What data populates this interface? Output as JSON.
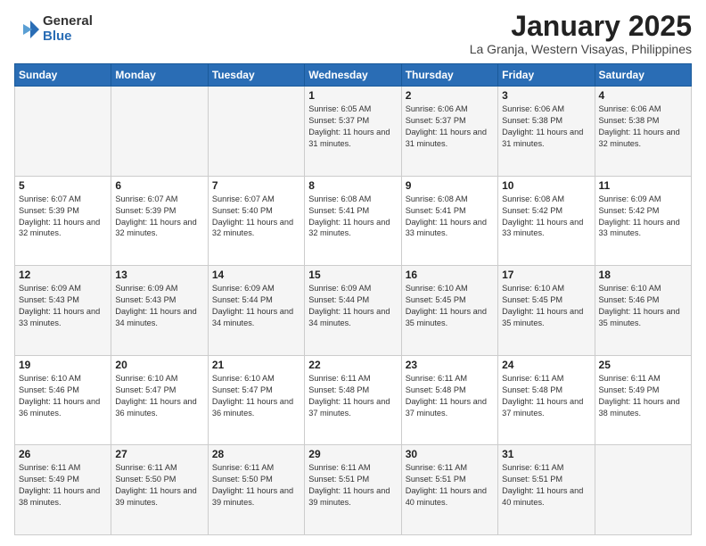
{
  "header": {
    "logo_general": "General",
    "logo_blue": "Blue",
    "month_title": "January 2025",
    "subtitle": "La Granja, Western Visayas, Philippines"
  },
  "weekdays": [
    "Sunday",
    "Monday",
    "Tuesday",
    "Wednesday",
    "Thursday",
    "Friday",
    "Saturday"
  ],
  "weeks": [
    [
      {
        "day": "",
        "info": ""
      },
      {
        "day": "",
        "info": ""
      },
      {
        "day": "",
        "info": ""
      },
      {
        "day": "1",
        "info": "Sunrise: 6:05 AM\nSunset: 5:37 PM\nDaylight: 11 hours\nand 31 minutes."
      },
      {
        "day": "2",
        "info": "Sunrise: 6:06 AM\nSunset: 5:37 PM\nDaylight: 11 hours\nand 31 minutes."
      },
      {
        "day": "3",
        "info": "Sunrise: 6:06 AM\nSunset: 5:38 PM\nDaylight: 11 hours\nand 31 minutes."
      },
      {
        "day": "4",
        "info": "Sunrise: 6:06 AM\nSunset: 5:38 PM\nDaylight: 11 hours\nand 32 minutes."
      }
    ],
    [
      {
        "day": "5",
        "info": "Sunrise: 6:07 AM\nSunset: 5:39 PM\nDaylight: 11 hours\nand 32 minutes."
      },
      {
        "day": "6",
        "info": "Sunrise: 6:07 AM\nSunset: 5:39 PM\nDaylight: 11 hours\nand 32 minutes."
      },
      {
        "day": "7",
        "info": "Sunrise: 6:07 AM\nSunset: 5:40 PM\nDaylight: 11 hours\nand 32 minutes."
      },
      {
        "day": "8",
        "info": "Sunrise: 6:08 AM\nSunset: 5:41 PM\nDaylight: 11 hours\nand 32 minutes."
      },
      {
        "day": "9",
        "info": "Sunrise: 6:08 AM\nSunset: 5:41 PM\nDaylight: 11 hours\nand 33 minutes."
      },
      {
        "day": "10",
        "info": "Sunrise: 6:08 AM\nSunset: 5:42 PM\nDaylight: 11 hours\nand 33 minutes."
      },
      {
        "day": "11",
        "info": "Sunrise: 6:09 AM\nSunset: 5:42 PM\nDaylight: 11 hours\nand 33 minutes."
      }
    ],
    [
      {
        "day": "12",
        "info": "Sunrise: 6:09 AM\nSunset: 5:43 PM\nDaylight: 11 hours\nand 33 minutes."
      },
      {
        "day": "13",
        "info": "Sunrise: 6:09 AM\nSunset: 5:43 PM\nDaylight: 11 hours\nand 34 minutes."
      },
      {
        "day": "14",
        "info": "Sunrise: 6:09 AM\nSunset: 5:44 PM\nDaylight: 11 hours\nand 34 minutes."
      },
      {
        "day": "15",
        "info": "Sunrise: 6:09 AM\nSunset: 5:44 PM\nDaylight: 11 hours\nand 34 minutes."
      },
      {
        "day": "16",
        "info": "Sunrise: 6:10 AM\nSunset: 5:45 PM\nDaylight: 11 hours\nand 35 minutes."
      },
      {
        "day": "17",
        "info": "Sunrise: 6:10 AM\nSunset: 5:45 PM\nDaylight: 11 hours\nand 35 minutes."
      },
      {
        "day": "18",
        "info": "Sunrise: 6:10 AM\nSunset: 5:46 PM\nDaylight: 11 hours\nand 35 minutes."
      }
    ],
    [
      {
        "day": "19",
        "info": "Sunrise: 6:10 AM\nSunset: 5:46 PM\nDaylight: 11 hours\nand 36 minutes."
      },
      {
        "day": "20",
        "info": "Sunrise: 6:10 AM\nSunset: 5:47 PM\nDaylight: 11 hours\nand 36 minutes."
      },
      {
        "day": "21",
        "info": "Sunrise: 6:10 AM\nSunset: 5:47 PM\nDaylight: 11 hours\nand 36 minutes."
      },
      {
        "day": "22",
        "info": "Sunrise: 6:11 AM\nSunset: 5:48 PM\nDaylight: 11 hours\nand 37 minutes."
      },
      {
        "day": "23",
        "info": "Sunrise: 6:11 AM\nSunset: 5:48 PM\nDaylight: 11 hours\nand 37 minutes."
      },
      {
        "day": "24",
        "info": "Sunrise: 6:11 AM\nSunset: 5:48 PM\nDaylight: 11 hours\nand 37 minutes."
      },
      {
        "day": "25",
        "info": "Sunrise: 6:11 AM\nSunset: 5:49 PM\nDaylight: 11 hours\nand 38 minutes."
      }
    ],
    [
      {
        "day": "26",
        "info": "Sunrise: 6:11 AM\nSunset: 5:49 PM\nDaylight: 11 hours\nand 38 minutes."
      },
      {
        "day": "27",
        "info": "Sunrise: 6:11 AM\nSunset: 5:50 PM\nDaylight: 11 hours\nand 39 minutes."
      },
      {
        "day": "28",
        "info": "Sunrise: 6:11 AM\nSunset: 5:50 PM\nDaylight: 11 hours\nand 39 minutes."
      },
      {
        "day": "29",
        "info": "Sunrise: 6:11 AM\nSunset: 5:51 PM\nDaylight: 11 hours\nand 39 minutes."
      },
      {
        "day": "30",
        "info": "Sunrise: 6:11 AM\nSunset: 5:51 PM\nDaylight: 11 hours\nand 40 minutes."
      },
      {
        "day": "31",
        "info": "Sunrise: 6:11 AM\nSunset: 5:51 PM\nDaylight: 11 hours\nand 40 minutes."
      },
      {
        "day": "",
        "info": ""
      }
    ]
  ]
}
